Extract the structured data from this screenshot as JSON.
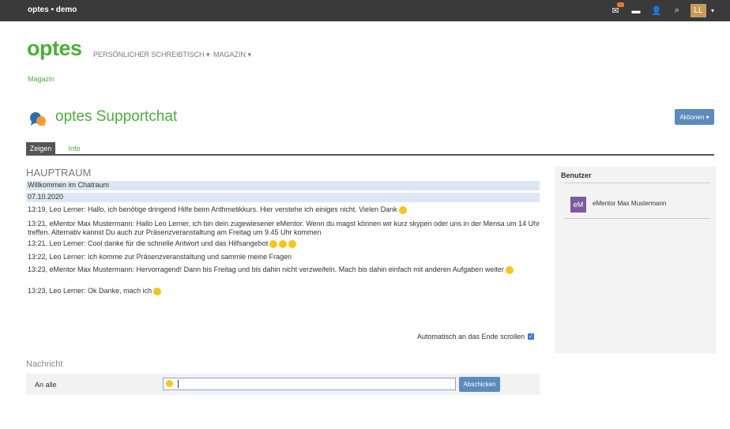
{
  "topbar": {
    "brand": "optes • demo",
    "icons": [
      "mail-icon",
      "chat-bubble-icon",
      "user-icon",
      "search-icon"
    ],
    "user_initials": "LL"
  },
  "header": {
    "logo": "optes",
    "nav": [
      "PERSÖNLICHER SCHREIBTISCH ▾",
      "MAGAZIN ▾"
    ]
  },
  "breadcrumb": "Magazin",
  "page": {
    "title": "optes Supportchat",
    "actions_label": "Aktionen ▾"
  },
  "tabs": [
    "Zeigen",
    "Info"
  ],
  "chat": {
    "room": "HAUPTRAUM",
    "welcome": "Willkommen im Chatraum",
    "date": "07.10.2020",
    "messages": [
      "13:19, Leo Lerner: Hallo, ich benötige dringend Hilfe beim Arithmetikkurs. Hier verstehe ich einiges nicht. Vielen Dank",
      "13:21, eMentor Max Mustermann: Hallo Leo Lerner, ich bin dein zugewiesener eMentor. Wenn du magst können wir kurz skypen oder uns in der Mensa um 14 Uhr treffen. Alternativ kannst Du auch zur Präsenzveranstaltung am Freitag um 9.45 Uhr kommen",
      "13:21, Leo Lerner: Cool danke für die schnelle Antwort und das Hilfsangebot",
      "13:22, Leo Lerner: Ich komme zur Präsenzveranstaltung und sammle meine Fragen",
      "13:23, eMentor Max Mustermann: Hervorragend! Dann bis Freitag und bis dahin nicht verzweifeln. Mach bis dahin einfach mit anderen Aufgaben weiter",
      "13:23, Leo Lerner: Ok Danke, mach ich"
    ],
    "autoscroll_label": "Automatisch an das Ende scrollen"
  },
  "compose": {
    "heading": "Nachricht",
    "recipient": "An alle",
    "input_value": "",
    "send_label": "Abschicken"
  },
  "sidebar": {
    "title": "Benutzer",
    "users": [
      {
        "initials": "eM",
        "name": "eMentor Max Mustermann"
      }
    ]
  }
}
